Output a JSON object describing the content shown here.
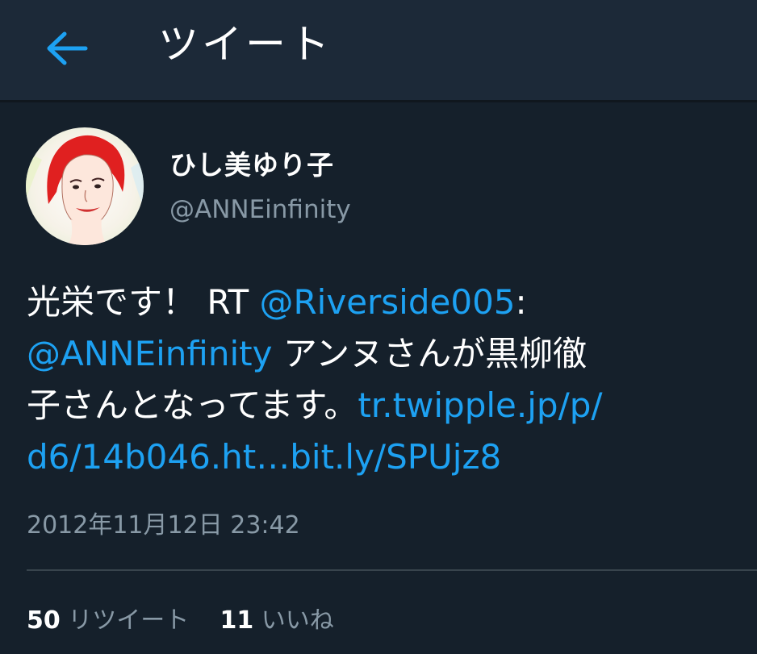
{
  "header": {
    "title": "ツイート"
  },
  "tweet": {
    "author": {
      "display_name": "ひし美ゆり子",
      "handle": "@ANNEinfinity"
    },
    "body": {
      "line1_text": "光栄です！ RT ",
      "line1_mention": "@Riverside005",
      "line1_colon": ":",
      "line2_mention": "@ANNEinfinity",
      "line2_text": " アンヌさんが黒柳徹",
      "line3_text": "子さんとなってます。",
      "line3_link": "tr.twipple.jp/p/",
      "line4_link1": "d6/14b046.ht…",
      "line4_link2": "bit.ly/SPUjz8"
    },
    "timestamp": "2012年11月12日 23:42",
    "retweets": {
      "count": "50",
      "label": "リツイート"
    },
    "likes": {
      "count": "11",
      "label": "いいね"
    }
  },
  "colors": {
    "background": "#15202b",
    "header": "#1c2938",
    "accent": "#1da1f2",
    "secondary_text": "#8899a6"
  }
}
